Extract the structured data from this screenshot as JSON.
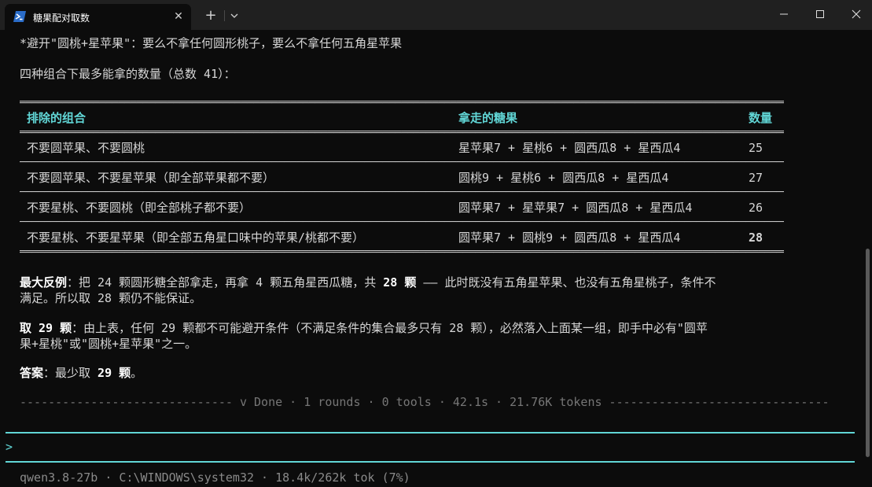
{
  "window": {
    "tab_title": "糖果配对取数",
    "close_glyph": "✕",
    "new_tab_glyph": "+",
    "icons": [
      "powershell-icon",
      "chevron-down-icon",
      "minimize-icon",
      "maximize-icon",
      "close-icon"
    ]
  },
  "text": {
    "line1": "*避开\"圆桃+星苹果\"：要么不拿任何圆形桃子，要么不拿任何五角星苹果",
    "line2": "四种组合下最多能拿的数量（总数 41）："
  },
  "table": {
    "headers": [
      "排除的组合",
      "拿走的糖果",
      "数量"
    ],
    "rows": [
      {
        "exclude": "不要圆苹果、不要圆桃",
        "taken": "星苹果7 + 星桃6 + 圆西瓜8 + 星西瓜4",
        "count": "25"
      },
      {
        "exclude": "不要圆苹果、不要星苹果（即全部苹果都不要）",
        "taken": "圆桃9 + 星桃6 + 圆西瓜8 + 星西瓜4",
        "count": "27"
      },
      {
        "exclude": "不要星桃、不要圆桃（即全部桃子都不要）",
        "taken": "圆苹果7 + 星苹果7 + 圆西瓜8 + 星西瓜4",
        "count": "26"
      },
      {
        "exclude": "不要星桃、不要星苹果（即全部五角星口味中的苹果/桃都不要）",
        "taken": "圆苹果7 + 圆桃9 + 圆西瓜8 + 星西瓜4",
        "count": "28"
      }
    ]
  },
  "paragraphs": {
    "p1_label": "最大反例",
    "p1_a": "：把 24 颗圆形糖全部拿走，再拿 4 颗五角星西瓜糖，共 ",
    "p1_bold": "28 颗",
    "p1_b": " —— 此时既没有五角星苹果、也没有五角星桃子，条件不",
    "p1_c": "满足。所以取 28 颗仍不能保证。",
    "p2_label": "取 29 颗",
    "p2_a": "：由上表，任何 29 颗都不可能避开条件（不满足条件的集合最多只有 28 颗），必然落入上面某一组，即手中必有\"圆苹",
    "p2_b": "果+星桃\"或\"圆桃+星苹果\"之一。",
    "p3_label": "答案",
    "p3_a": "：最少取 ",
    "p3_bold": "29 颗",
    "p3_b": "。"
  },
  "status_line": "------------------------------ v Done · 1 rounds · 0 tools · 42.1s · 21.76K tokens -------------------------------",
  "prompt": ">",
  "footer": "qwen3.8-27b · C:\\WINDOWS\\system32 · 18.4k/262k tok (7%)",
  "colors": {
    "background": "#0c0c0c",
    "titlebar": "#202020",
    "accent": "#61d6d6",
    "text": "#d6d6d6"
  }
}
